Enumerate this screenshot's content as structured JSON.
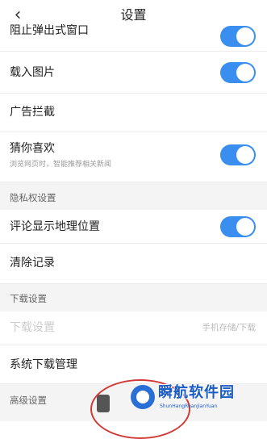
{
  "header": {
    "title": "设置",
    "back_icon": "chevron-left-icon"
  },
  "rows": {
    "block_popup": {
      "label": "阻止弹出式窗口",
      "toggle_on": true
    },
    "load_images": {
      "label": "载入图片",
      "toggle_on": true
    },
    "ad_block": {
      "label": "广告拦截"
    },
    "guess_like": {
      "label": "猜你喜欢",
      "sub": "浏览网页时，智能推荐相关新闻",
      "toggle_on": true
    },
    "show_location": {
      "label": "评论显示地理位置",
      "toggle_on": true
    },
    "clear_records": {
      "label": "清除记录"
    },
    "download_settings": {
      "label": "下载设置",
      "value": "手机存储/下载"
    },
    "system_download": {
      "label": "系统下载管理"
    }
  },
  "sections": {
    "privacy": "隐私权设置",
    "download": "下载设置",
    "advanced": "高级设置"
  },
  "watermark": {
    "text": "瞬航软件园",
    "sub": "ShunHangRuanJianYuan"
  },
  "colors": {
    "toggle_on": "#3a8ef0",
    "section_bg": "#f4f4f4",
    "annotation": "#d13b36"
  }
}
